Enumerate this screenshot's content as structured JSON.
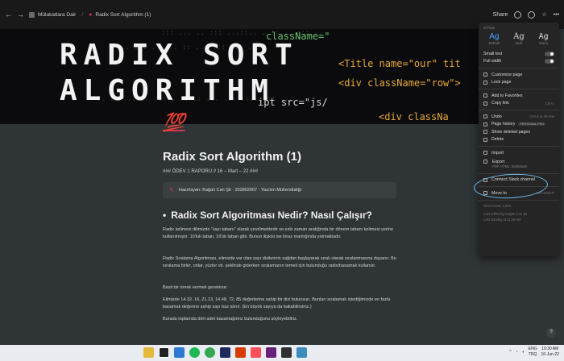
{
  "topbar": {
    "breadcrumb_parent": "Mülakatlara Dair",
    "breadcrumb_current": "Radix Sort Algorithm (1)",
    "share_label": "Share"
  },
  "cover": {
    "title_line1": "RADIX SORT",
    "title_line2": "ALGORITHM",
    "code_lines": [
      "className=\"",
      "<Title name=\"our\" tit",
      "<div className=\"row\">",
      "ipt src=\"js/",
      "<div classNa"
    ]
  },
  "page": {
    "icon": "💯",
    "title": "Radix Sort Algorithm (1)",
    "subtitle": "### ÖDEV 1 RAPORU // 16 – Mart – 22 ###",
    "callout": "Hazırlayan: Kağan Can Şit  ·  202802007  ·  Yazılım Mühendisliği",
    "heading": "Radix Sort Algoritması Nedir? Nasıl Çalışır?",
    "paragraphs": [
      "Radix kelimesi dilimizde \"sayı tabanı\" olarak çevrilmektedir ve eski zaman aralığında bir dönem tabanı kelimesi yerine kullanılmıştır. 10'luk taban, 16'lık taban gibi. Bunun ilişkisi ise biraz mantığında yatmaktadır.",
      "Radix Sıralama Algoritması, elimizde var olan sayı dizilerinin sağdan başlayarak sıralı olarak sıralanmasına dayanır. Bu sıralama birler, onlar, yüzler vb. şeklinde giderken sıralamanın temeli için bulunduğu radix/basamak kullanılır.",
      "Basit bir örnek vermek gerekirse;",
      "Elimizde 14.32, 16, 21.13, 14.48, 72, 85 değerlerine sahip bir dizi bulunsun. Bunları sıralamak istediğimizde en fazla basamak değerine sahip sayı baz alınır. (En büyük sayıya da bakabilirsiniz.)",
      "Burada toplamda dört adet basamağımız bulunduğunu söyleyebiliriz."
    ]
  },
  "menu": {
    "style_header": "STYLE",
    "styles": [
      {
        "ag": "Ag",
        "label": "Default"
      },
      {
        "ag": "Ag",
        "label": "Serif"
      },
      {
        "ag": "Ag",
        "label": "Mono"
      }
    ],
    "small_text": "Small text",
    "full_width": "Full width",
    "customize_page": "Customize page",
    "lock_page": "Lock page",
    "add_to_favorites": "Add to Favorites",
    "copy_link": "Copy link",
    "copy_link_shortcut": "Ctrl+L",
    "undo": "Undo",
    "undo_shortcut": "Ctrl+Z or Alt+Del",
    "page_history": "Page history",
    "page_history_badge": "PERSONAL PRO",
    "show_deleted_pages": "Show deleted pages",
    "delete": "Delete",
    "import": "Import",
    "export": "Export",
    "export_desc": "PDF, HTML, Markdown",
    "connect_slack": "Connect Slack channel",
    "move_to": "Move to",
    "move_to_shortcut": "Ctrl+Shift+P",
    "word_count": "Word count: 1,815",
    "last_edited_by": "Last edited by Kağan Can Şit",
    "last_edited_time": "Last Sunday at 11:29 AM"
  },
  "taskbar": {
    "lang_line1": "ENG",
    "lang_line2": "TRQ",
    "time": "10:30 AM",
    "date": "16-Jun-22"
  }
}
